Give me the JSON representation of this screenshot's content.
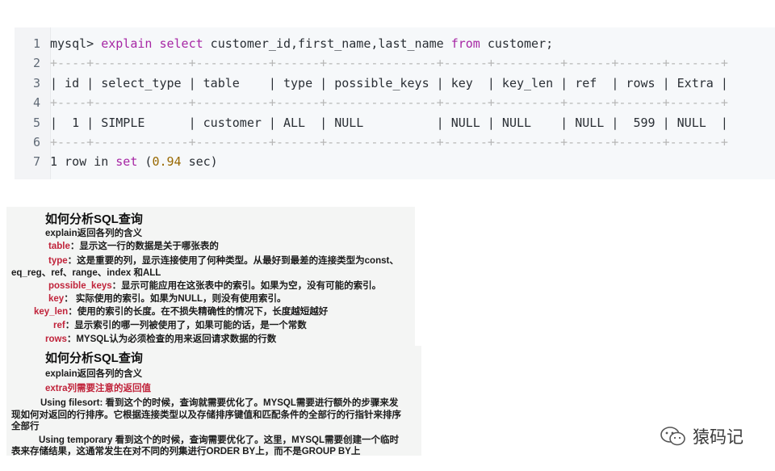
{
  "code_block": {
    "lines": [
      {
        "n": "1",
        "parts": [
          {
            "t": "mysql> ",
            "c": ""
          },
          {
            "t": "explain",
            "c": "kw"
          },
          {
            "t": " ",
            "c": ""
          },
          {
            "t": "select",
            "c": "kw"
          },
          {
            "t": " customer_id,first_name,last_name ",
            "c": ""
          },
          {
            "t": "from",
            "c": "kw"
          },
          {
            "t": " customer;",
            "c": ""
          }
        ]
      },
      {
        "n": "2",
        "parts": [
          {
            "t": "+----+-------------+----------+------+---------------+------+---------+------+------+-------+",
            "c": "sep"
          }
        ]
      },
      {
        "n": "3",
        "parts": [
          {
            "t": "| id | select_type | table    | type | possible_keys | key  | key_len | ref  | rows | Extra |",
            "c": ""
          }
        ]
      },
      {
        "n": "4",
        "parts": [
          {
            "t": "+----+-------------+----------+------+---------------+------+---------+------+------+-------+",
            "c": "sep"
          }
        ]
      },
      {
        "n": "5",
        "parts": [
          {
            "t": "|  1 | SIMPLE      | customer | ALL  | NULL          | NULL | NULL    | NULL |  599 | NULL  |",
            "c": ""
          }
        ]
      },
      {
        "n": "6",
        "parts": [
          {
            "t": "+----+-------------+----------+------+---------------+------+---------+------+------+-------+",
            "c": "sep"
          }
        ]
      },
      {
        "n": "7",
        "parts": [
          {
            "t": "1 row in ",
            "c": ""
          },
          {
            "t": "set",
            "c": "kw"
          },
          {
            "t": " (",
            "c": ""
          },
          {
            "t": "0.94",
            "c": "num"
          },
          {
            "t": " sec)",
            "c": ""
          }
        ]
      }
    ]
  },
  "panel1": {
    "title": "如何分析SQL查询",
    "subtitle": "explain返回各列的含义",
    "lines": [
      {
        "term": "table",
        "text": "：显示这一行的数据是关于哪张表的"
      },
      {
        "term": "type",
        "text": "：这是重要的列，显示连接使用了何种类型。从最好到最差的连接类型为const、"
      },
      {
        "term": "",
        "text": "eq_reg、ref、range、index 和ALL"
      },
      {
        "term": "possible_keys",
        "text": "：显示可能应用在这张表中的索引。如果为空，没有可能的索引。"
      },
      {
        "term": "key",
        "text": "：  实际使用的索引。如果为NULL，则没有使用索引。"
      },
      {
        "term": "key_len",
        "text": "：使用的索引的长度。在不损失精确性的情况下，长度越短越好"
      },
      {
        "term": "ref",
        "text": "：显示索引的哪一列被使用了，如果可能的话，是一个常数"
      },
      {
        "term": "rows",
        "text": "：MYSQL认为必须检查的用来返回请求数据的行数"
      }
    ]
  },
  "panel2": {
    "title": "如何分析SQL查询",
    "subtitle": "explain返回各列的含义",
    "highlight": "extra列需要注意的返回值",
    "paragraphs": [
      "Using filesort: 看到这个的时候，查询就需要优化了。MYSQL需要进行额外的步骤来发",
      "现如何对返回的行排序。它根据连接类型以及存储排序键值和匹配条件的全部行的行指针来排序",
      "全部行",
      "Using temporary 看到这个的时候，查询需要优化了。这里，MYSQL需要创建一个临时",
      "表来存储结果，这通常发生在对不同的列集进行ORDER BY上，而不是GROUP BY上"
    ]
  },
  "watermark": {
    "text": "猿码记",
    "icon": "wechat-icon"
  }
}
